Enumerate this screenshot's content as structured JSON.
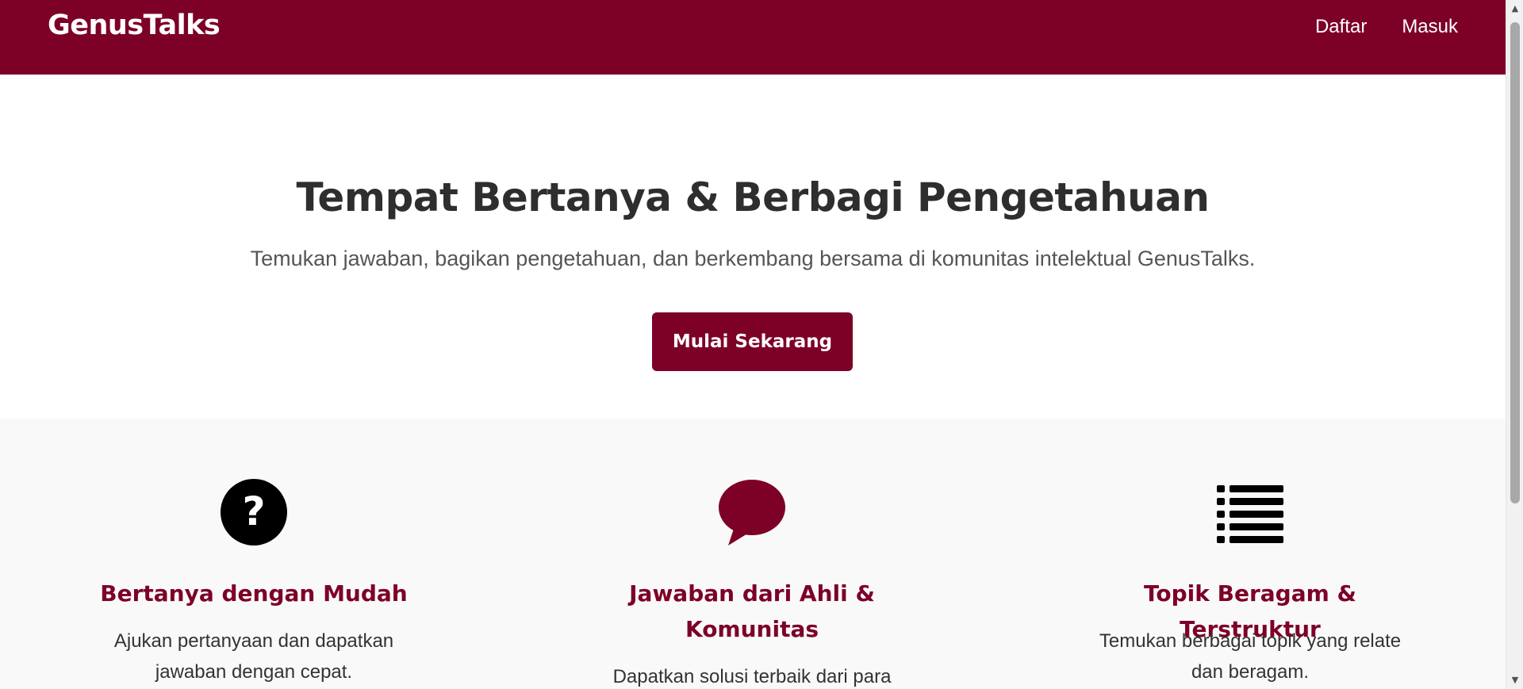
{
  "header": {
    "brand": "GenusTalks",
    "nav": [
      {
        "label": "Daftar"
      },
      {
        "label": "Masuk"
      }
    ]
  },
  "hero": {
    "title": "Tempat Bertanya & Berbagi Pengetahuan",
    "subtitle": "Temukan jawaban, bagikan pengetahuan, dan berkembang bersama di komunitas intelektual GenusTalks.",
    "cta_label": "Mulai Sekarang"
  },
  "features": [
    {
      "icon": "question-circle-icon",
      "title": "Bertanya dengan Mudah",
      "description": "Ajukan pertanyaan dan dapatkan jawaban dengan cepat."
    },
    {
      "icon": "speech-bubble-icon",
      "title": "Jawaban dari Ahli & Komunitas",
      "description": "Dapatkan solusi terbaik dari para"
    },
    {
      "icon": "list-icon",
      "title": "Topik Beragam & Terstruktur",
      "description": "Temukan berbagai topik yang relate dan beragam."
    }
  ],
  "colors": {
    "brand": "#7d0027",
    "feature_background": "#f9f9f9",
    "text_dark": "#2e2e2e"
  }
}
